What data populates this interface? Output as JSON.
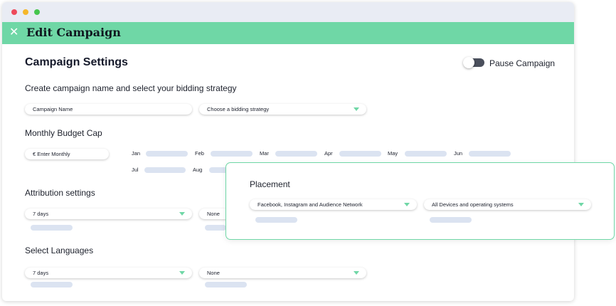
{
  "header": {
    "title": "Edit Campaign",
    "close_icon": "close-icon"
  },
  "settings": {
    "title": "Campaign Settings",
    "pause_label": "Pause Campaign",
    "pause_enabled": false,
    "subtitle": "Create campaign name and select your bidding strategy",
    "campaign_name_placeholder": "Campaign Name",
    "bidding_placeholder": "Choose a bidding strategy"
  },
  "budget": {
    "title": "Monthly Budget Cap",
    "monthly_placeholder": "€ Enter Monthly",
    "months": [
      "Jan",
      "Feb",
      "Mar",
      "Apr",
      "May",
      "Jun",
      "Jul",
      "Aug"
    ]
  },
  "attribution": {
    "title": "Attribution settings",
    "window_value": "7 days",
    "second_value": "None"
  },
  "languages": {
    "title": "Select Languages",
    "first_value": "7 days",
    "second_value": "None"
  },
  "placement": {
    "title": "Placement",
    "network_value": "Facebook, Instagram and Audience Network",
    "devices_value": "All Devices and operating systems"
  },
  "colors": {
    "accent": "#6fd7a6",
    "placeholder_bar": "#dbe3f1",
    "titlebar": "#e9ecf4"
  }
}
